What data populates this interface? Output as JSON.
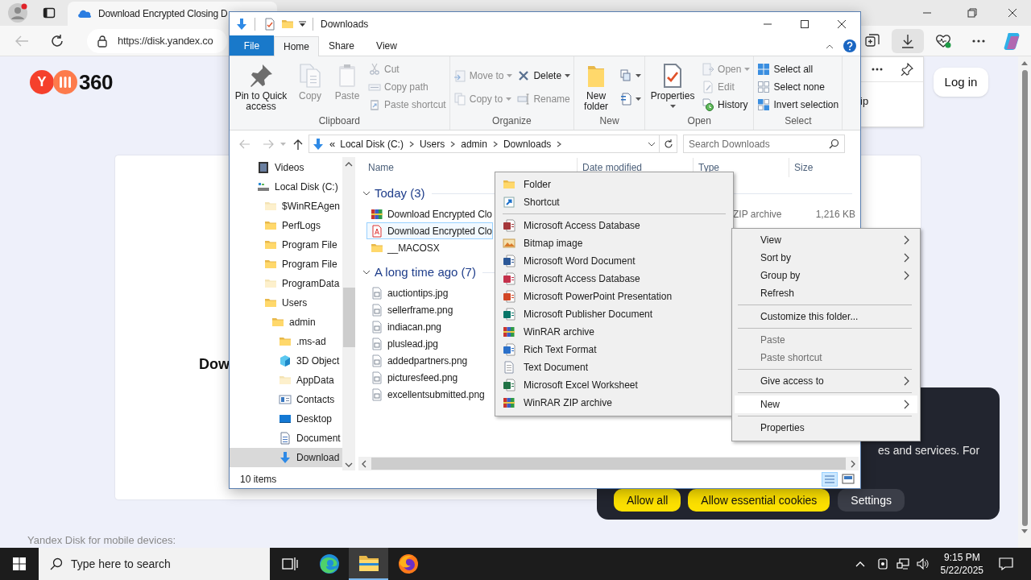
{
  "browser": {
    "tab_title": "Download Encrypted Closing D",
    "url": "https://disk.yandex.co"
  },
  "page": {
    "logo": {
      "letter": "Y",
      "text": "360"
    },
    "login_button": "Log in",
    "heading": "Dow",
    "downloads_panel_text": "ip",
    "mobile_text": "Yandex Disk for mobile devices:"
  },
  "cookie_banner": {
    "text": "es and services. For",
    "buttons": [
      {
        "label": "Allow all",
        "kind": "primary"
      },
      {
        "label": "Allow essential cookies",
        "kind": "primary"
      },
      {
        "label": "Settings",
        "kind": "secondary"
      }
    ]
  },
  "explorer": {
    "title": "Downloads",
    "ribbon_tabs": [
      {
        "label": "File",
        "kind": "file",
        "selected": false
      },
      {
        "label": "Home",
        "kind": "tab",
        "selected": true
      },
      {
        "label": "Share",
        "kind": "tab",
        "selected": false
      },
      {
        "label": "View",
        "kind": "tab",
        "selected": false
      }
    ],
    "ribbon_groups": [
      {
        "label": "Clipboard",
        "columns": [
          [
            {
              "kind": "pin",
              "label": "Pin to Quick access",
              "disabled": false
            }
          ],
          [
            {
              "kind": "copy",
              "label": "Copy",
              "disabled": true
            }
          ],
          [
            {
              "kind": "paste",
              "label": "Paste",
              "disabled": true
            }
          ],
          [
            {
              "kind": "cut",
              "label": "Cut",
              "disabled": true
            },
            {
              "kind": "copypath",
              "label": "Copy path",
              "disabled": true
            },
            {
              "kind": "pasteshortcut",
              "label": "Paste shortcut",
              "disabled": true
            }
          ]
        ]
      },
      {
        "label": "Organize",
        "columns": [
          [
            {
              "kind": "moveto",
              "label": "Move to",
              "disabled": true,
              "dropdown": true
            },
            {
              "kind": "copyto",
              "label": "Copy to",
              "disabled": true,
              "dropdown": true
            }
          ],
          [
            {
              "kind": "delete",
              "label": "Delete",
              "disabled": false,
              "dropdown": true
            },
            {
              "kind": "rename",
              "label": "Rename",
              "disabled": true
            }
          ]
        ]
      },
      {
        "label": "New",
        "columns": [
          [
            {
              "kind": "newfolder",
              "label": "New folder",
              "disabled": false
            }
          ],
          [
            {
              "kind": "newitem",
              "disabled": false,
              "dropdown": true
            },
            {
              "kind": "easyaccess",
              "disabled": false,
              "dropdown": true
            }
          ]
        ]
      },
      {
        "label": "Open",
        "columns": [
          [
            {
              "kind": "properties",
              "label": "Properties",
              "disabled": false,
              "dropdown": true
            }
          ],
          [
            {
              "kind": "open",
              "label": "Open",
              "disabled": true,
              "dropdown": true
            },
            {
              "kind": "edit",
              "label": "Edit",
              "disabled": true
            },
            {
              "kind": "history",
              "label": "History",
              "disabled": false
            }
          ]
        ]
      },
      {
        "label": "Select",
        "columns": [
          [
            {
              "kind": "selectall",
              "label": "Select all",
              "disabled": false
            },
            {
              "kind": "selectnone",
              "label": "Select none",
              "disabled": false
            },
            {
              "kind": "invert",
              "label": "Invert selection",
              "disabled": false
            }
          ]
        ]
      }
    ],
    "address": {
      "overflow": "«",
      "crumbs": [
        "Local Disk (C:)",
        "Users",
        "admin",
        "Downloads"
      ]
    },
    "search_placeholder": "Search Downloads",
    "nav": [
      {
        "label": "Videos",
        "kind": "video",
        "selected": false
      },
      {
        "label": "Local Disk (C:)",
        "kind": "drive",
        "selected": false,
        "children": [
          {
            "label": "$WinREAgen",
            "kind": "hidden-folder",
            "selected": false
          },
          {
            "label": "PerfLogs",
            "kind": "folder",
            "selected": false
          },
          {
            "label": "Program File",
            "kind": "folder",
            "selected": false
          },
          {
            "label": "Program File",
            "kind": "folder",
            "selected": false
          },
          {
            "label": "ProgramData",
            "kind": "hidden-folder",
            "selected": false
          },
          {
            "label": "Users",
            "kind": "folder",
            "selected": false,
            "children": [
              {
                "label": "admin",
                "kind": "folder",
                "selected": false,
                "children": [
                  {
                    "label": ".ms-ad",
                    "kind": "folder",
                    "selected": false
                  },
                  {
                    "label": "3D Object",
                    "kind": "cube",
                    "selected": false
                  },
                  {
                    "label": "AppData",
                    "kind": "hidden-folder",
                    "selected": false
                  },
                  {
                    "label": "Contacts",
                    "kind": "contacts",
                    "selected": false
                  },
                  {
                    "label": "Desktop",
                    "kind": "desktop",
                    "selected": false
                  },
                  {
                    "label": "Document",
                    "kind": "documents",
                    "selected": false
                  },
                  {
                    "label": "Download",
                    "kind": "downloads",
                    "selected": true
                  }
                ]
              }
            ]
          }
        ]
      }
    ],
    "columns": [
      "Name",
      "Date modified",
      "Type",
      "Size"
    ],
    "groups": [
      {
        "label": "Today (3)",
        "expanded": true,
        "files": [
          {
            "name": "Download Encrypted Clo",
            "kind": "rar",
            "selected": false,
            "type": "ZIP archive",
            "size": "1,216 KB"
          },
          {
            "name": "Download Encrypted Clo",
            "kind": "pdf",
            "selected": true
          },
          {
            "name": "__MACOSX",
            "kind": "folder",
            "selected": false
          }
        ]
      },
      {
        "label": "A long time ago (7)",
        "expanded": true,
        "files": [
          {
            "name": "auctiontips.jpg",
            "kind": "image",
            "selected": false
          },
          {
            "name": "sellerframe.png",
            "kind": "image",
            "selected": false
          },
          {
            "name": "indiacan.png",
            "kind": "image",
            "selected": false
          },
          {
            "name": "pluslead.jpg",
            "kind": "image",
            "selected": false
          },
          {
            "name": "addedpartners.png",
            "kind": "image",
            "selected": false
          },
          {
            "name": "picturesfeed.png",
            "kind": "image",
            "selected": false
          },
          {
            "name": "excellentsubmitted.png",
            "kind": "image",
            "selected": false
          }
        ]
      }
    ],
    "status": "10 items"
  },
  "context_menu": {
    "items": [
      {
        "kind": "item",
        "label": "View",
        "submenu": true,
        "disabled": false,
        "selected": false
      },
      {
        "kind": "item",
        "label": "Sort by",
        "submenu": true,
        "disabled": false,
        "selected": false
      },
      {
        "kind": "item",
        "label": "Group by",
        "submenu": true,
        "disabled": false,
        "selected": false
      },
      {
        "kind": "item",
        "label": "Refresh",
        "submenu": false,
        "disabled": false,
        "selected": false
      },
      {
        "kind": "separator"
      },
      {
        "kind": "item",
        "label": "Customize this folder...",
        "submenu": false,
        "disabled": false,
        "selected": false
      },
      {
        "kind": "separator"
      },
      {
        "kind": "item",
        "label": "Paste",
        "submenu": false,
        "disabled": true,
        "selected": false
      },
      {
        "kind": "item",
        "label": "Paste shortcut",
        "submenu": false,
        "disabled": true,
        "selected": false
      },
      {
        "kind": "separator"
      },
      {
        "kind": "item",
        "label": "Give access to",
        "submenu": true,
        "disabled": false,
        "selected": false
      },
      {
        "kind": "separator"
      },
      {
        "kind": "item",
        "label": "New",
        "submenu": true,
        "disabled": false,
        "selected": true
      },
      {
        "kind": "separator"
      },
      {
        "kind": "item",
        "label": "Properties",
        "submenu": false,
        "disabled": false,
        "selected": false
      }
    ]
  },
  "new_submenu": {
    "items": [
      {
        "kind": "folder",
        "label": "Folder"
      },
      {
        "kind": "shortcut",
        "label": "Shortcut"
      },
      {
        "kind": "separator"
      },
      {
        "kind": "access",
        "label": "Microsoft Access Database"
      },
      {
        "kind": "bitmap",
        "label": "Bitmap image"
      },
      {
        "kind": "word",
        "label": "Microsoft Word Document"
      },
      {
        "kind": "access2",
        "label": "Microsoft Access Database"
      },
      {
        "kind": "powerpoint",
        "label": "Microsoft PowerPoint Presentation"
      },
      {
        "kind": "publisher",
        "label": "Microsoft Publisher Document"
      },
      {
        "kind": "rar",
        "label": "WinRAR archive"
      },
      {
        "kind": "rtf",
        "label": "Rich Text Format"
      },
      {
        "kind": "text",
        "label": "Text Document"
      },
      {
        "kind": "excel",
        "label": "Microsoft Excel Worksheet"
      },
      {
        "kind": "rar",
        "label": "WinRAR ZIP archive"
      }
    ]
  },
  "taskbar": {
    "search_placeholder": "Type here to search",
    "apps": [
      {
        "kind": "taskview",
        "active": false
      },
      {
        "kind": "edge",
        "active": false
      },
      {
        "kind": "explorer",
        "active": true
      },
      {
        "kind": "firefox",
        "active": false
      }
    ],
    "time": "9:15 PM",
    "date": "5/22/2025"
  }
}
